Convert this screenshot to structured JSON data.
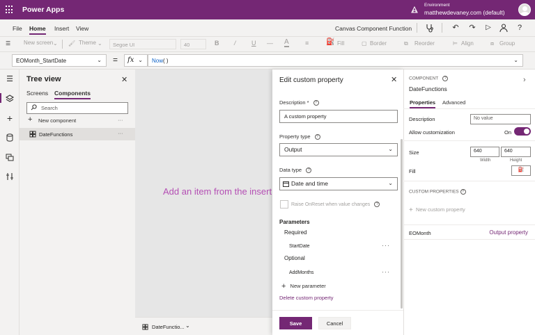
{
  "topbar": {
    "app_title": "Power Apps",
    "environment_label": "Environment",
    "environment_value": "matthewdevaney.com (default)"
  },
  "menu": {
    "items": [
      "File",
      "Home",
      "Insert",
      "View"
    ],
    "active": "Home",
    "app_name": "Canvas Component Function"
  },
  "format_toolbar": {
    "new_screen": "New screen",
    "theme": "Theme",
    "font": "Segoe UI",
    "font_size": "40",
    "bold": "B",
    "fill": "Fill",
    "border": "Border",
    "reorder": "Reorder",
    "align": "Align",
    "group": "Group"
  },
  "formula_bar": {
    "property": "EOMonth_StartDate",
    "equals": "=",
    "fx": "fx",
    "formula_fn": "Now",
    "formula_rest": "( )"
  },
  "tree_view": {
    "title": "Tree view",
    "tabs": [
      "Screens",
      "Components"
    ],
    "active_tab": "Components",
    "search_placeholder": "Search",
    "new_component": "New component",
    "component": "DateFunctions",
    "more": "···"
  },
  "canvas": {
    "hint": "Add an item from the insert",
    "screen_selector": "DateFunctio..."
  },
  "modal": {
    "title": "Edit custom property",
    "description_label": "Description *",
    "description_value": "A custom property",
    "property_type_label": "Property type",
    "property_type_value": "Output",
    "data_type_label": "Data type",
    "data_type_value": "Date and time",
    "raise_onreset_label": "Raise OnReset when value changes",
    "parameters_title": "Parameters",
    "required_label": "Required",
    "required_param": "StartDate",
    "optional_label": "Optional",
    "optional_param": "AddMonths",
    "new_parameter": "New parameter",
    "delete_property": "Delete custom property",
    "save": "Save",
    "cancel": "Cancel",
    "more": "···"
  },
  "properties_pane": {
    "section": "COMPONENT",
    "component_name": "DateFunctions",
    "tabs": [
      "Properties",
      "Advanced"
    ],
    "active_tab": "Properties",
    "description_label": "Description",
    "description_placeholder": "No value",
    "allow_customization_label": "Allow customization",
    "allow_customization_state": "On",
    "size_label": "Size",
    "width_value": "640",
    "height_value": "640",
    "width_label": "Width",
    "height_label": "Height",
    "fill_label": "Fill",
    "custom_properties_title": "CUSTOM PROPERTIES",
    "new_custom_property": "New custom property",
    "custom_property_name": "EOMonth",
    "custom_property_type": "Output property"
  },
  "colors": {
    "brand": "#742774",
    "hint": "#b44fb4",
    "link": "#0e62c7"
  }
}
